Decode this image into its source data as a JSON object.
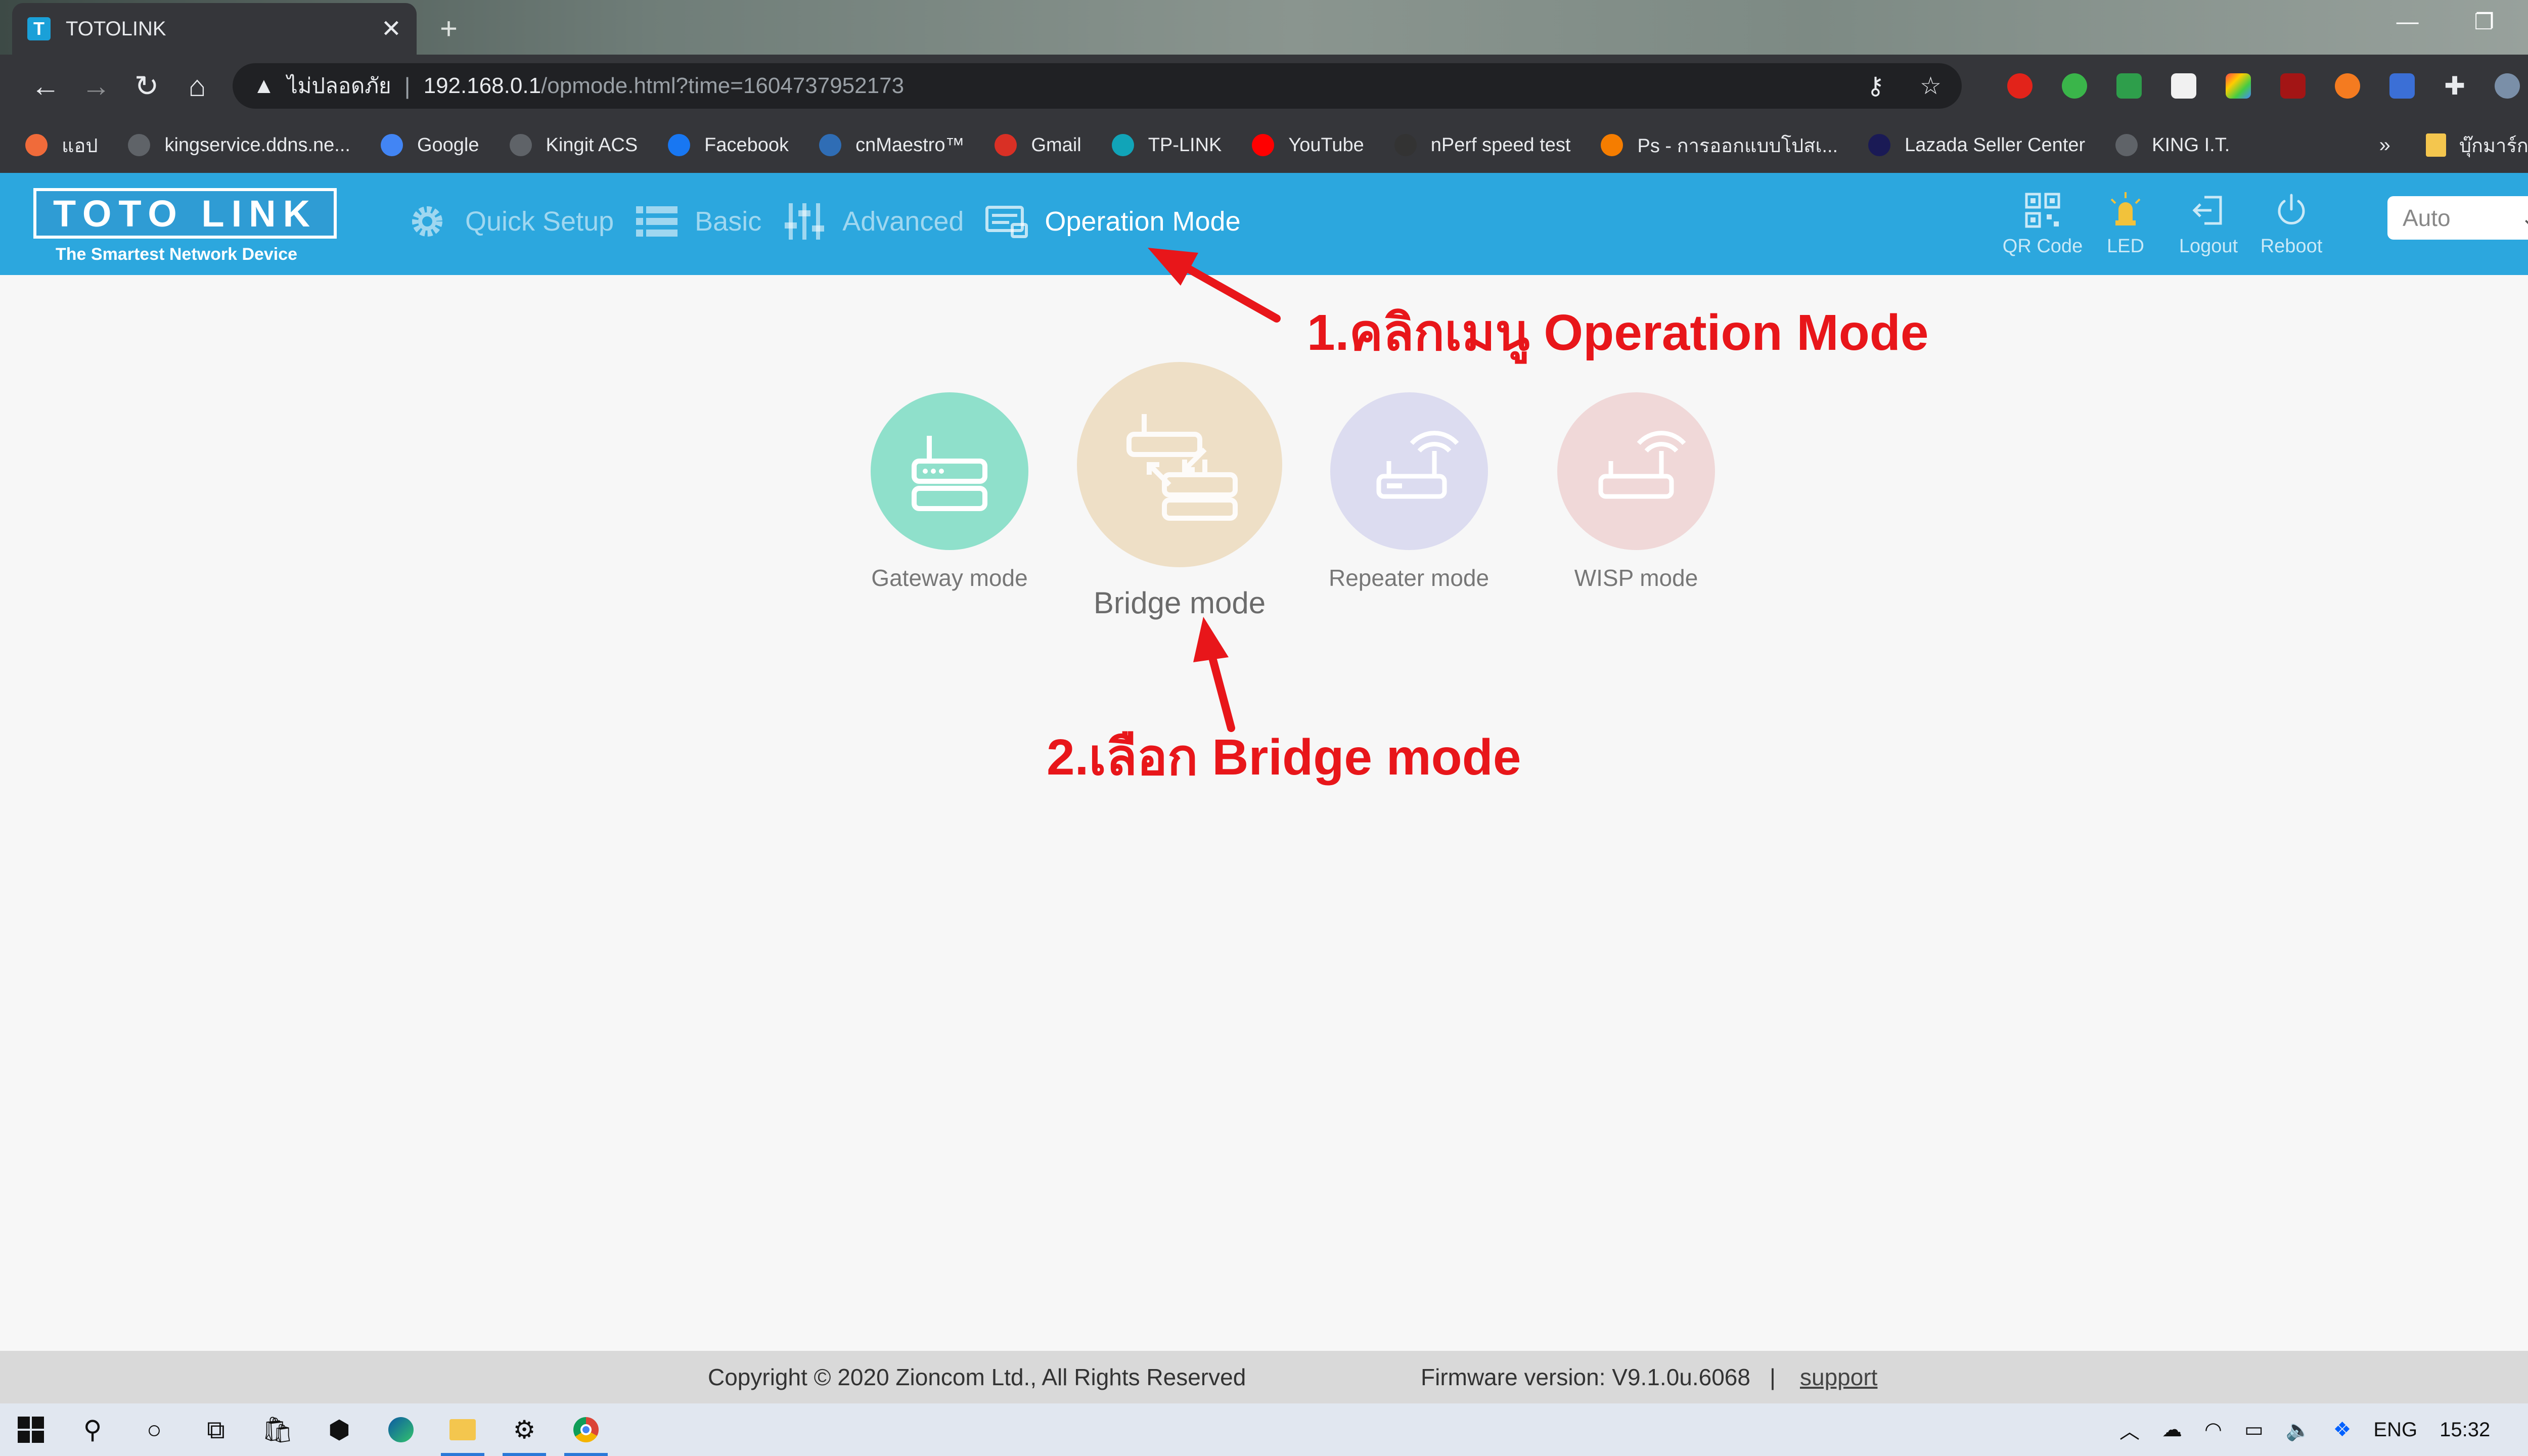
{
  "browser": {
    "tab_title": "TOTOLINK",
    "tab_favicon": "T",
    "new_tab": "+",
    "insecure_label": "ไม่ปลอดภัย",
    "url_host": "192.168.0.1",
    "url_path": "/opmode.html?time=1604737952173",
    "bookmarks": [
      {
        "label": "แอป",
        "icon": "apps-icon",
        "color": "#f06b3a"
      },
      {
        "label": "kingservice.ddns.ne...",
        "icon": "globe-icon",
        "color": "#5f6368"
      },
      {
        "label": "Google",
        "icon": "google-icon",
        "color": "#4285f4"
      },
      {
        "label": "Kingit ACS",
        "icon": "globe-icon",
        "color": "#5f6368"
      },
      {
        "label": "Facebook",
        "icon": "facebook-icon",
        "color": "#1877f2"
      },
      {
        "label": "cnMaestro™",
        "icon": "cnmaestro-icon",
        "color": "#2f6db5"
      },
      {
        "label": "Gmail",
        "icon": "gmail-icon",
        "color": "#d93025"
      },
      {
        "label": "TP-LINK",
        "icon": "tplink-icon",
        "color": "#11a4b8"
      },
      {
        "label": "YouTube",
        "icon": "youtube-icon",
        "color": "#ff0000"
      },
      {
        "label": "nPerf speed test",
        "icon": "nperf-icon",
        "color": "#333333"
      },
      {
        "label": "Ps - การออกแบบโปสเ...",
        "icon": "blogger-icon",
        "color": "#f57d00"
      },
      {
        "label": "Lazada Seller Center",
        "icon": "lazada-icon",
        "color": "#1a1a55"
      },
      {
        "label": "KING I.T.",
        "icon": "globe-icon",
        "color": "#5f6368"
      }
    ],
    "more_bookmarks": "»",
    "other_bookmarks": "บุ๊กมาร์กอื่นๆ"
  },
  "router": {
    "logo_text": "TOTO LINK",
    "logo_tagline": "The Smartest Network Device",
    "nav": [
      {
        "label": "Quick Setup",
        "icon": "gear-icon",
        "active": false
      },
      {
        "label": "Basic",
        "icon": "list-icon",
        "active": false
      },
      {
        "label": "Advanced",
        "icon": "sliders-icon",
        "active": false
      },
      {
        "label": "Operation Mode",
        "icon": "operation-mode-icon",
        "active": true
      }
    ],
    "tools": [
      {
        "label": "QR Code",
        "icon": "qr-code-icon"
      },
      {
        "label": "LED",
        "icon": "led-icon"
      },
      {
        "label": "Logout",
        "icon": "logout-icon"
      },
      {
        "label": "Reboot",
        "icon": "power-icon"
      }
    ],
    "language": "Auto",
    "modes": [
      {
        "label": "Gateway mode",
        "icon": "gateway-router-icon",
        "color": "#8fe0cb"
      },
      {
        "label": "Bridge mode",
        "icon": "bridge-routers-icon",
        "color": "#eedfc6"
      },
      {
        "label": "Repeater mode",
        "icon": "repeater-router-icon",
        "color": "#dcdcf0"
      },
      {
        "label": "WISP mode",
        "icon": "wisp-router-icon",
        "color": "#f0d8d8"
      }
    ],
    "footer": {
      "copyright": "Copyright © 2020 Zioncom Ltd., All Rights Reserved",
      "firmware": "Firmware version: V9.1.0u.6068",
      "separator": "|",
      "support": "support"
    }
  },
  "annotations": {
    "step1": "1.คลิกเมนู Operation Mode",
    "step2": "2.เลือก Bridge mode",
    "color": "#e8161a"
  },
  "taskbar": {
    "language": "ENG",
    "time": "15:32"
  },
  "colors": {
    "header_blue": "#2ca7de",
    "footer_gray": "#d9d9d9",
    "chrome_dark": "#35363a"
  }
}
